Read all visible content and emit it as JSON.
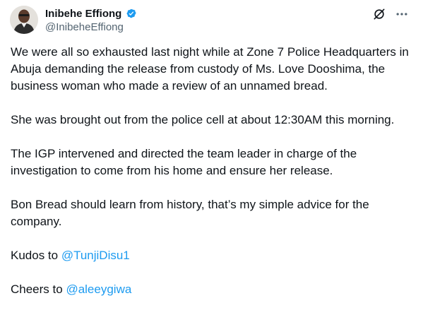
{
  "author": {
    "display_name": "Inibehe Effiong",
    "handle": "@InibeheEffiong",
    "verified_icon": "verified-badge-icon",
    "verified_color": "#1d9bf0"
  },
  "actions": {
    "grok_icon": "grok-icon",
    "more_icon": "more-icon"
  },
  "tweet": {
    "p1": "We were all so exhausted last night while at Zone 7 Police Headquarters in Abuja demanding the release from custody of Ms. Love Dooshima, the business woman who made a review of an unnamed bread.",
    "p2": "She was brought out from the police cell at about 12:30AM this morning.",
    "p3": "The IGP intervened and directed the team leader in charge of the investigation to come from his home and ensure her release.",
    "p4": "Bon Bread should learn from history, that’s my simple advice for the company.",
    "p5_prefix": "Kudos to ",
    "p5_mention": "@TunjiDisu1",
    "p6_prefix": "Cheers to ",
    "p6_mention": "@aleeygiwa"
  },
  "colors": {
    "text": "#0f1419",
    "secondary": "#536471",
    "link": "#1d9bf0"
  }
}
